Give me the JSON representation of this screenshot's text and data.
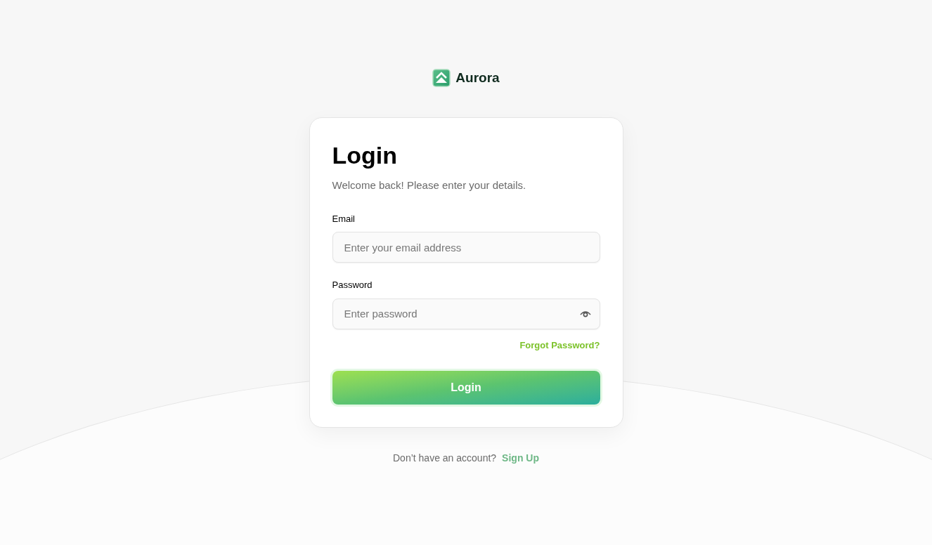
{
  "brand": {
    "name": "Aurora"
  },
  "card": {
    "title": "Login",
    "subtitle": "Welcome back! Please enter your details.",
    "fields": [
      {
        "kind": "email",
        "label": "Email",
        "placeholder": "Enter your email address"
      },
      {
        "kind": "password",
        "label": "Password",
        "placeholder": "Enter password"
      }
    ],
    "forgot_link": "Forgot Password?",
    "submit_button": "Login"
  },
  "footer": {
    "prompt": "Don’t have an account?",
    "link": "Sign Up"
  }
}
